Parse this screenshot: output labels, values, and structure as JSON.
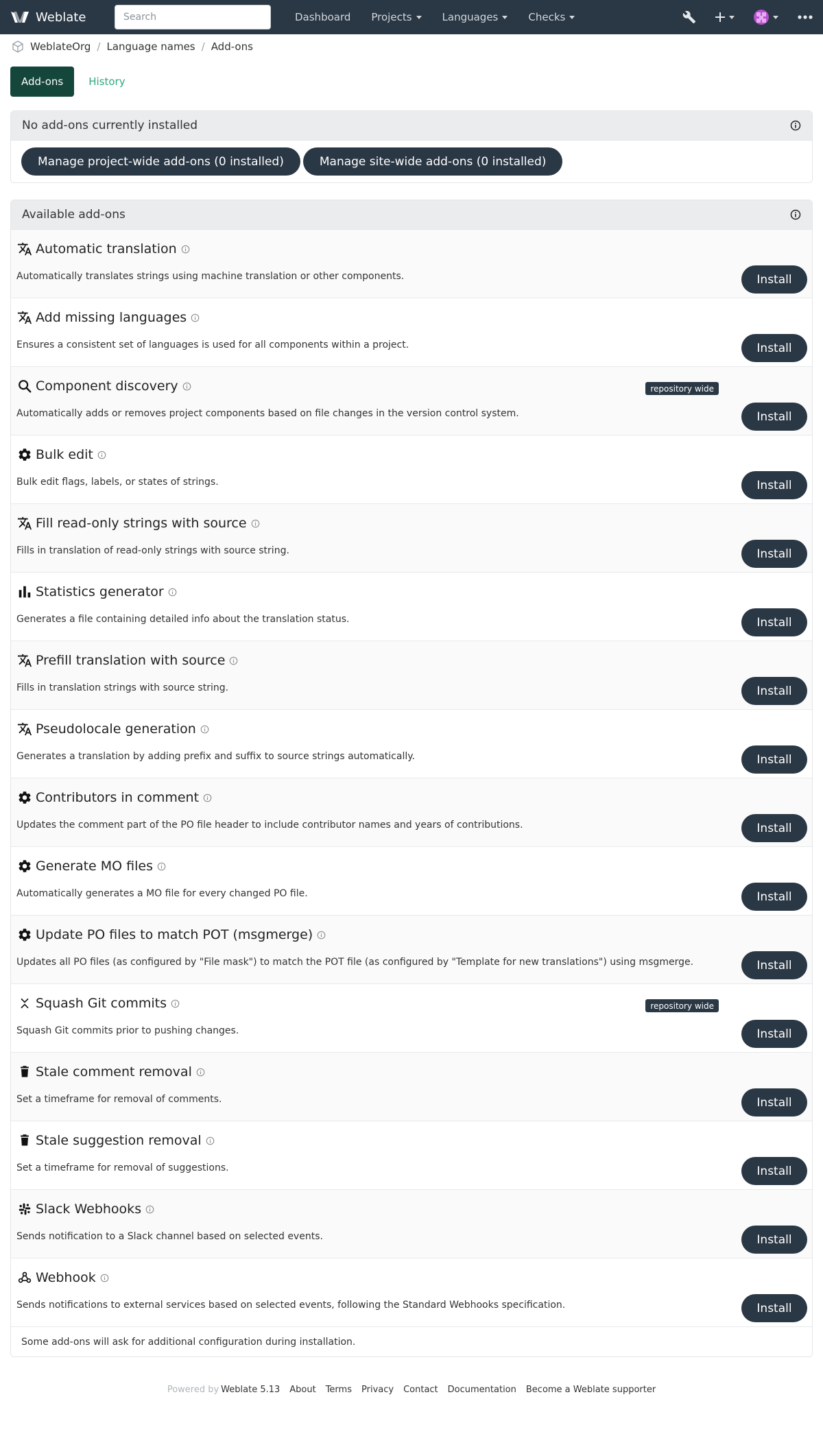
{
  "nav": {
    "brand": "Weblate",
    "search_placeholder": "Search",
    "links": [
      {
        "label": "Dashboard",
        "caret": false
      },
      {
        "label": "Projects",
        "caret": true
      },
      {
        "label": "Languages",
        "caret": true
      },
      {
        "label": "Checks",
        "caret": true
      }
    ]
  },
  "breadcrumb": [
    "WeblateOrg",
    "Language names",
    "Add-ons"
  ],
  "tabs": [
    "Add-ons",
    "History"
  ],
  "installed": {
    "title": "No add-ons currently installed",
    "project_btn": "Manage project-wide add-ons (0 installed)",
    "site_btn": "Manage site-wide add-ons (0 installed)"
  },
  "available": {
    "title": "Available add-ons",
    "install_label": "Install",
    "badge_label": "repository wide",
    "footer_note": "Some add-ons will ask for additional configuration during installation.",
    "addons": [
      {
        "name": "Automatic translation",
        "desc": "Automatically translates strings using machine translation or other components.",
        "icon": "translate-icon",
        "badge": false
      },
      {
        "name": "Add missing languages",
        "desc": "Ensures a consistent set of languages is used for all components within a project.",
        "icon": "translate-icon",
        "badge": false
      },
      {
        "name": "Component discovery",
        "desc": "Automatically adds or removes project components based on file changes in the version control system.",
        "icon": "search-icon",
        "badge": true
      },
      {
        "name": "Bulk edit",
        "desc": "Bulk edit flags, labels, or states of strings.",
        "icon": "gear-icon",
        "badge": false
      },
      {
        "name": "Fill read-only strings with source",
        "desc": "Fills in translation of read-only strings with source string.",
        "icon": "translate-icon",
        "badge": false
      },
      {
        "name": "Statistics generator",
        "desc": "Generates a file containing detailed info about the translation status.",
        "icon": "bar-chart-icon",
        "badge": false
      },
      {
        "name": "Prefill translation with source",
        "desc": "Fills in translation strings with source string.",
        "icon": "translate-icon",
        "badge": false
      },
      {
        "name": "Pseudolocale generation",
        "desc": "Generates a translation by adding prefix and suffix to source strings automatically.",
        "icon": "translate-icon",
        "badge": false
      },
      {
        "name": "Contributors in comment",
        "desc": "Updates the comment part of the PO file header to include contributor names and years of contributions.",
        "icon": "gear-icon",
        "badge": false
      },
      {
        "name": "Generate MO files",
        "desc": "Automatically generates a MO file for every changed PO file.",
        "icon": "gear-icon",
        "badge": false
      },
      {
        "name": "Update PO files to match POT (msgmerge)",
        "desc": "Updates all PO files (as configured by \"File mask\") to match the POT file (as configured by \"Template for new translations\") using msgmerge.",
        "icon": "gear-icon",
        "badge": false
      },
      {
        "name": "Squash Git commits",
        "desc": "Squash Git commits prior to pushing changes.",
        "icon": "squash-icon",
        "badge": true
      },
      {
        "name": "Stale comment removal",
        "desc": "Set a timeframe for removal of comments.",
        "icon": "trash-icon",
        "badge": false
      },
      {
        "name": "Stale suggestion removal",
        "desc": "Set a timeframe for removal of suggestions.",
        "icon": "trash-icon",
        "badge": false
      },
      {
        "name": "Slack Webhooks",
        "desc": "Sends notification to a Slack channel based on selected events.",
        "icon": "slack-icon",
        "badge": false
      },
      {
        "name": "Webhook",
        "desc": "Sends notifications to external services based on selected events, following the Standard Webhooks specification.",
        "icon": "webhook-icon",
        "badge": false
      }
    ]
  },
  "footer": {
    "powered_by": "Powered by",
    "version": "Weblate 5.13",
    "links": [
      "About",
      "Terms",
      "Privacy",
      "Contact",
      "Documentation",
      "Become a Weblate supporter"
    ]
  }
}
